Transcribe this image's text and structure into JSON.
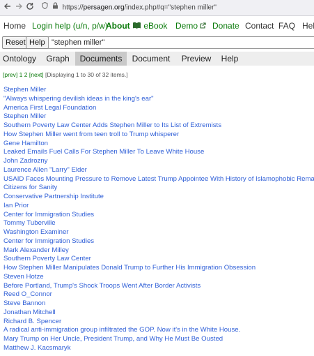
{
  "browser": {
    "back_icon": "arrow-left-icon",
    "forward_icon": "arrow-right-icon",
    "reload_icon": "reload-icon",
    "url_prefix": "https://",
    "url_host": "persagen.org",
    "url_rest": "/index.php#q=\"stephen miller\""
  },
  "topnav": {
    "home": "Home",
    "login_help": "Login help (u/n, p/w)",
    "about": "About",
    "ebook": "eBook",
    "demo": "Demo",
    "donate": "Donate",
    "contact": "Contact",
    "faq": "FAQ",
    "help": "Help"
  },
  "search": {
    "reset_label": "Reset",
    "help_label": "Help",
    "query": "\"stephen miller\""
  },
  "tabs": [
    "Ontology",
    "Graph",
    "Documents",
    "Document",
    "Preview",
    "Help"
  ],
  "active_tab": "Documents",
  "pager": {
    "prev": "[prev]",
    "page1": "1",
    "page2": "2",
    "next": "[next]",
    "status": "[Displaying 1 to 30 of 32 items.]"
  },
  "results": [
    "Stephen Miller",
    "\"Always whispering devilish ideas in the king's ear\"",
    "America First Legal Foundation",
    "Stephen Miller",
    "Southern Poverty Law Center Adds Stephen Miller to Its List of Extremists",
    "How Stephen Miller went from teen troll to Trump whisperer",
    "Gene Hamilton",
    "Leaked Emails Fuel Calls For Stephen Miller To Leave White House",
    "John Zadrozny",
    "Laurence Allen \"Larry\" Elder",
    "USAID Faces Mounting Pressure to Remove Latest Trump Appointee With History of Islamophobic Remarks",
    "Citizens for Sanity",
    "Conservative Partnership Institute",
    "Ian Prior",
    "Center for Immigration Studies",
    "Tommy Tuberville",
    "Washington Examiner",
    "Center for Immigration Studies",
    "Mark Alexander Milley",
    "Southern Poverty Law Center",
    "How Stephen Miller Manipulates Donald Trump to Further His Immigration Obsession",
    "Steven Hotze",
    "Before Portland, Trump's Shock Troops Went After Border Activists",
    "Reed O_Connor",
    "Steve Bannon",
    "Jonathan Mitchell",
    "Richard B. Spencer",
    "A radical anti-immigration group infiltrated the GOP. Now it's in the White House.",
    "Mary Trump on Her Uncle, President Trump, and Why He Must Be Ousted",
    "Matthew J. Kacsmaryk"
  ]
}
